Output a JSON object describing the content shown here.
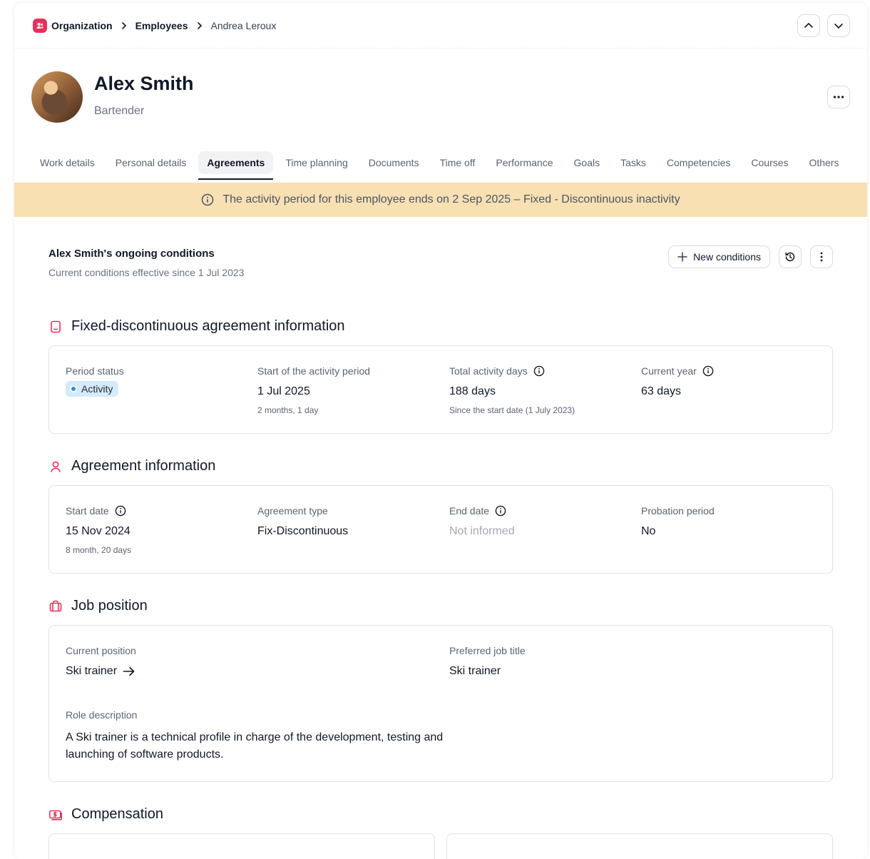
{
  "breadcrumb": {
    "root": "Organization",
    "section": "Employees",
    "current": "Andrea Leroux"
  },
  "profile": {
    "name": "Alex Smith",
    "role": "Bartender"
  },
  "tabs": [
    "Work details",
    "Personal details",
    "Agreements",
    "Time planning",
    "Documents",
    "Time off",
    "Performance",
    "Goals",
    "Tasks",
    "Competencies",
    "Courses",
    "Others"
  ],
  "active_tab": "Agreements",
  "banner": {
    "text": "The activity period for this employee ends on 2 Sep 2025 – Fixed - Discontinuous inactivity",
    "color": "#f8e0b3"
  },
  "conditions": {
    "title": "Alex Smith's ongoing conditions",
    "subtitle": "Current conditions effective since 1 Jul 2023",
    "new_button": "New conditions"
  },
  "fixed_section": {
    "title": "Fixed-discontinuous agreement information",
    "period_status_label": "Period status",
    "period_status_value": "Activity",
    "start_label": "Start of the activity period",
    "start_value": "1 Jul 2025",
    "start_note": "2 months, 1 day",
    "total_label": "Total activity days",
    "total_value": "188 days",
    "total_note": "Since the start date (1 July 2023)",
    "year_label": "Current year",
    "year_value": "63 days"
  },
  "agreement_section": {
    "title": "Agreement information",
    "start_label": "Start date",
    "start_value": "15 Nov 2024",
    "start_note": "8 month, 20 days",
    "type_label": "Agreement type",
    "type_value": "Fix-Discontinuous",
    "end_label": "End date",
    "end_value": "Not informed",
    "probation_label": "Probation period",
    "probation_value": "No"
  },
  "job_section": {
    "title": "Job position",
    "current_label": "Current position",
    "current_value": "Ski trainer",
    "preferred_label": "Preferred job title",
    "preferred_value": "Ski trainer",
    "role_label": "Role description",
    "role_value": "A Ski trainer is a technical profile in charge of the development, testing and launching of software products."
  },
  "compensation_section": {
    "title": "Compensation"
  },
  "colors": {
    "accent": "#e5315b",
    "status_pill": "#d5ebfb"
  },
  "icons": [
    "organization-icon",
    "chevron-right-icon",
    "chevron-up-icon",
    "chevron-down-icon",
    "more-horizontal-icon",
    "info-icon",
    "plus-icon",
    "history-icon",
    "more-vertical-icon",
    "document-icon",
    "person-icon",
    "briefcase-icon",
    "money-icon",
    "arrow-right-icon"
  ]
}
